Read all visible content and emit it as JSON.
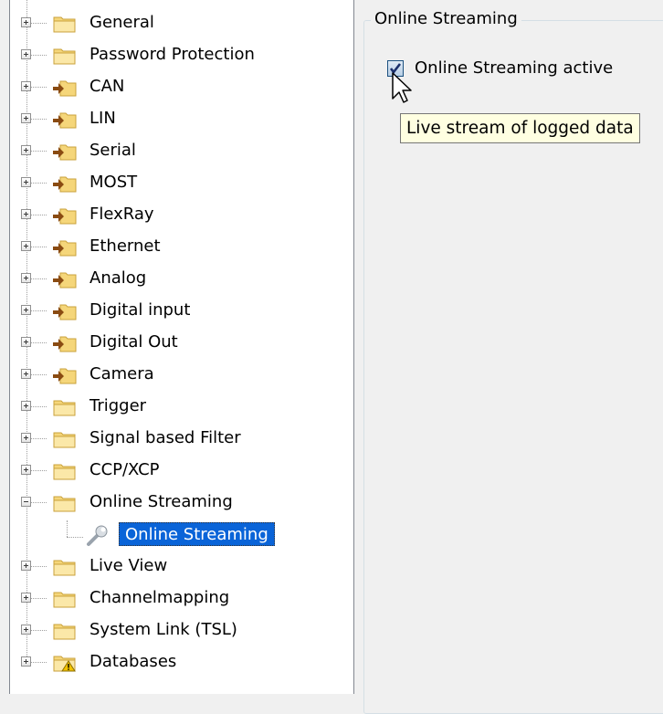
{
  "tree": {
    "items": [
      {
        "label": "General",
        "icon": "folder-icon"
      },
      {
        "label": "Password Protection",
        "icon": "folder-icon"
      },
      {
        "label": "CAN",
        "icon": "bus-folder-icon"
      },
      {
        "label": "LIN",
        "icon": "bus-folder-icon"
      },
      {
        "label": "Serial",
        "icon": "bus-folder-icon"
      },
      {
        "label": "MOST",
        "icon": "bus-folder-icon"
      },
      {
        "label": "FlexRay",
        "icon": "bus-folder-icon"
      },
      {
        "label": "Ethernet",
        "icon": "bus-folder-icon"
      },
      {
        "label": "Analog",
        "icon": "bus-folder-icon"
      },
      {
        "label": "Digital input",
        "icon": "bus-folder-icon"
      },
      {
        "label": "Digital Out",
        "icon": "bus-folder-icon"
      },
      {
        "label": "Camera",
        "icon": "bus-folder-icon"
      },
      {
        "label": "Trigger",
        "icon": "folder-icon"
      },
      {
        "label": "Signal based Filter",
        "icon": "folder-icon"
      },
      {
        "label": "CCP/XCP",
        "icon": "folder-icon"
      },
      {
        "label": "Online Streaming",
        "icon": "folder-icon",
        "expanded": true
      },
      {
        "label": "Live View",
        "icon": "folder-icon"
      },
      {
        "label": "Channelmapping",
        "icon": "folder-icon"
      },
      {
        "label": "System Link (TSL)",
        "icon": "folder-icon"
      },
      {
        "label": "Databases",
        "icon": "warning-folder-icon"
      }
    ],
    "selected_child": {
      "label": "Online Streaming",
      "icon": "wrench-icon"
    }
  },
  "panel": {
    "group_title": "Online Streaming",
    "checkbox_label": "Online Streaming active",
    "checkbox_checked": true,
    "tooltip": "Live stream of logged data"
  },
  "colors": {
    "selection": "#0a64d8",
    "folder": "#f5d67a",
    "tooltip_bg": "#ffffe1"
  }
}
